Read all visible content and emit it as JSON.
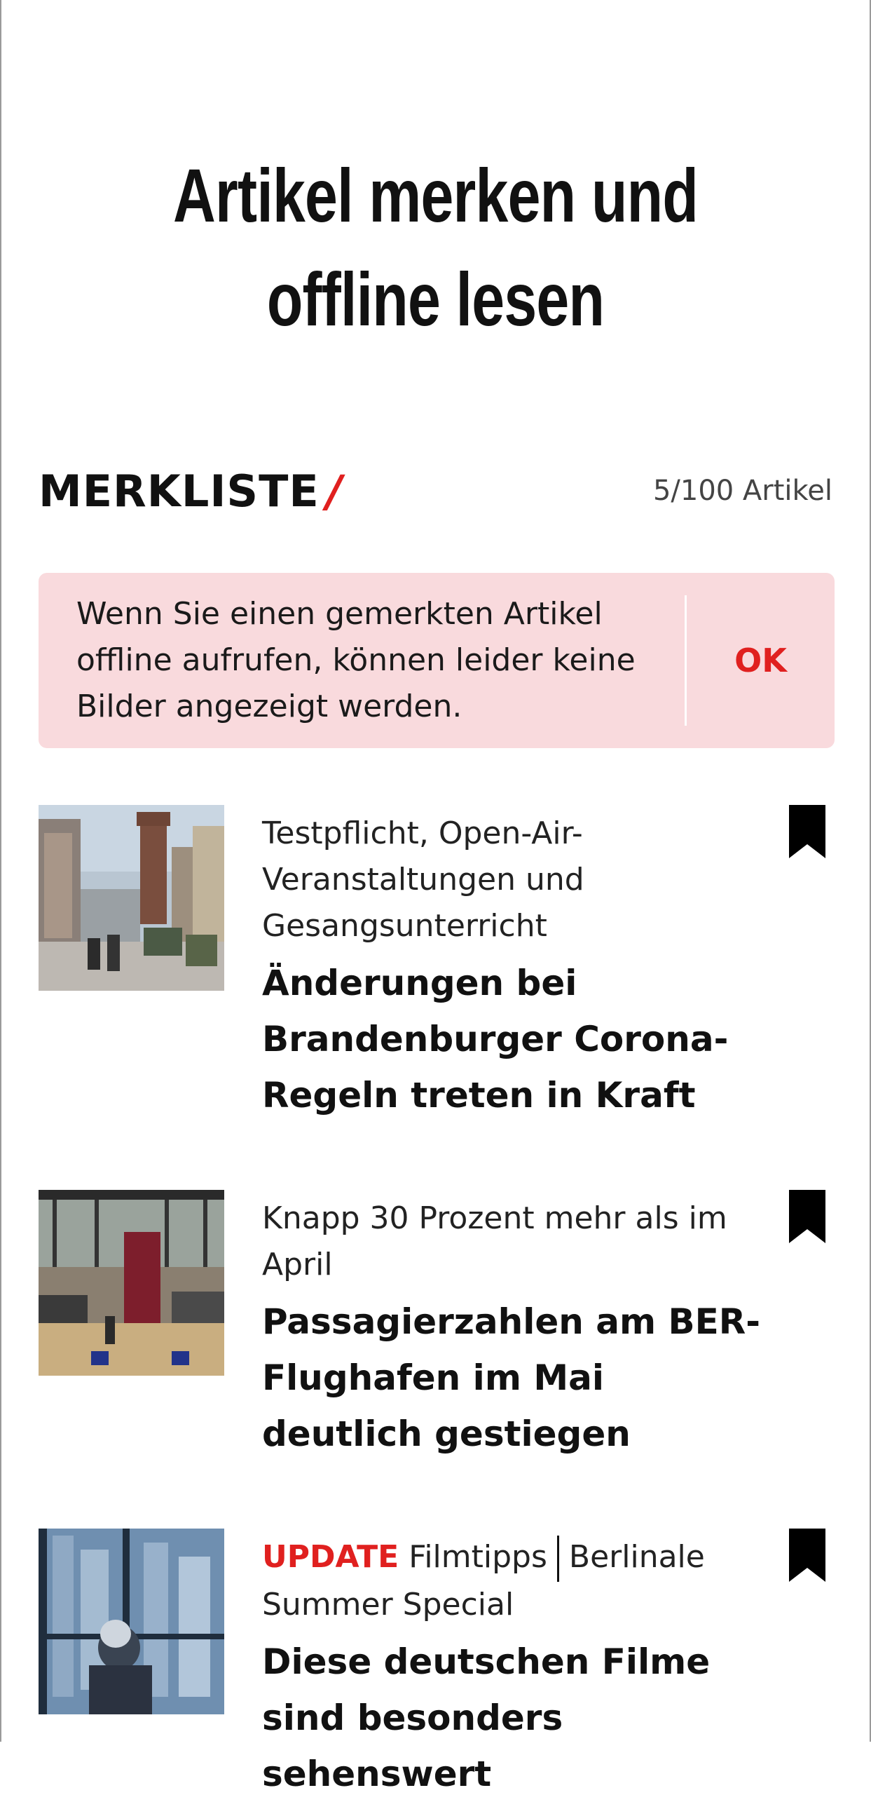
{
  "hero": {
    "title_line1": "Artikel merken und",
    "title_line2": "offline lesen"
  },
  "merkliste": {
    "title": "MERKLISTE",
    "slash": "/",
    "count": "5/100 Artikel"
  },
  "notice": {
    "text": "Wenn Sie einen gemerkten Artikel offline aufrufen, können leider keine Bilder angezeigt werden.",
    "ok_label": "OK"
  },
  "articles": [
    {
      "kicker": "Testpflicht, Open-Air-Veranstaltungen und Gesangsunterricht",
      "headline": "Änderungen bei Brandenburger Corona-Regeln treten in Kraft",
      "bookmark_icon": "bookmark-filled-icon"
    },
    {
      "kicker": "Knapp 30 Prozent mehr als im April",
      "headline": "Passagierzahlen am BER-Flughafen im Mai deutlich gestiegen",
      "bookmark_icon": "bookmark-filled-icon"
    },
    {
      "update_label": "UPDATE",
      "kicker": "Filmtipps",
      "kicker_secondary": "Berlinale Summer Special",
      "headline": "Diese deutschen Filme sind besonders sehenswert",
      "bookmark_icon": "bookmark-filled-icon"
    }
  ],
  "colors": {
    "accent": "#e0201f",
    "notice_bg": "#f9dadd",
    "text": "#111111"
  }
}
